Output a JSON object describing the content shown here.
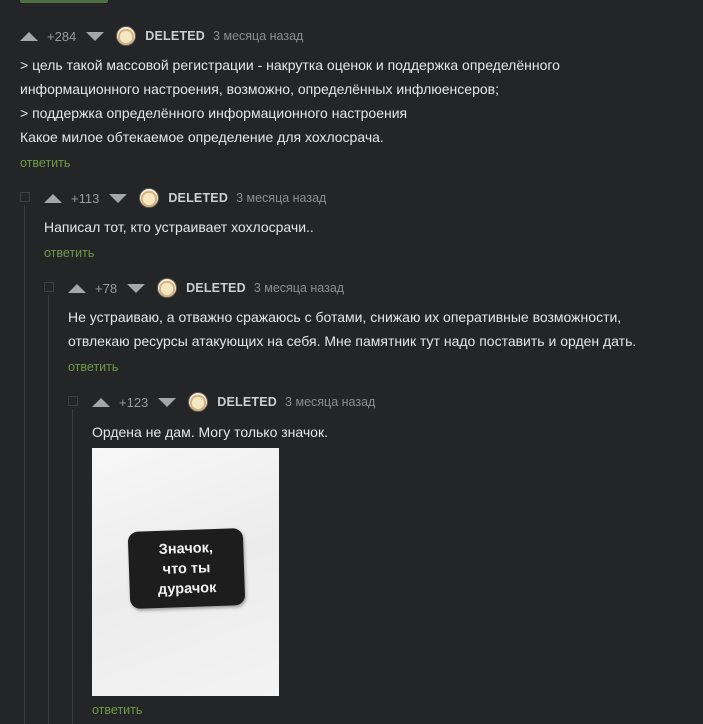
{
  "comments": [
    {
      "rating": "+284",
      "author": "DELETED",
      "time": "3 месяца назад",
      "lines": [
        "> цель такой массовой регистрации - накрутка оценок и поддержка определённого",
        "информационного настроения, возможно, определённых инфлюенсеров;",
        "> поддержка определённого информационного настроения",
        "Какое милое обтекаемое определение для хохлосрача."
      ],
      "reply_label": "ответить"
    },
    {
      "rating": "+113",
      "author": "DELETED",
      "time": "3 месяца назад",
      "lines": [
        "Написал тот, кто устраивает хохлосрачи.."
      ],
      "reply_label": "ответить"
    },
    {
      "rating": "+78",
      "author": "DELETED",
      "time": "3 месяца назад",
      "lines": [
        "Не устраиваю, а отважно сражаюсь с ботами, снижаю их оперативные возможности,",
        "отвлекаю ресурсы атакующих на себя. Мне памятник тут надо поставить и орден дать."
      ],
      "reply_label": "ответить"
    },
    {
      "rating": "+123",
      "author": "DELETED",
      "time": "3 месяца назад",
      "lines": [
        "Ордена не дам. Могу только значок."
      ],
      "image_text": [
        "Значок,",
        "что ты",
        "дурачок"
      ],
      "reply_label": "ответить"
    }
  ]
}
